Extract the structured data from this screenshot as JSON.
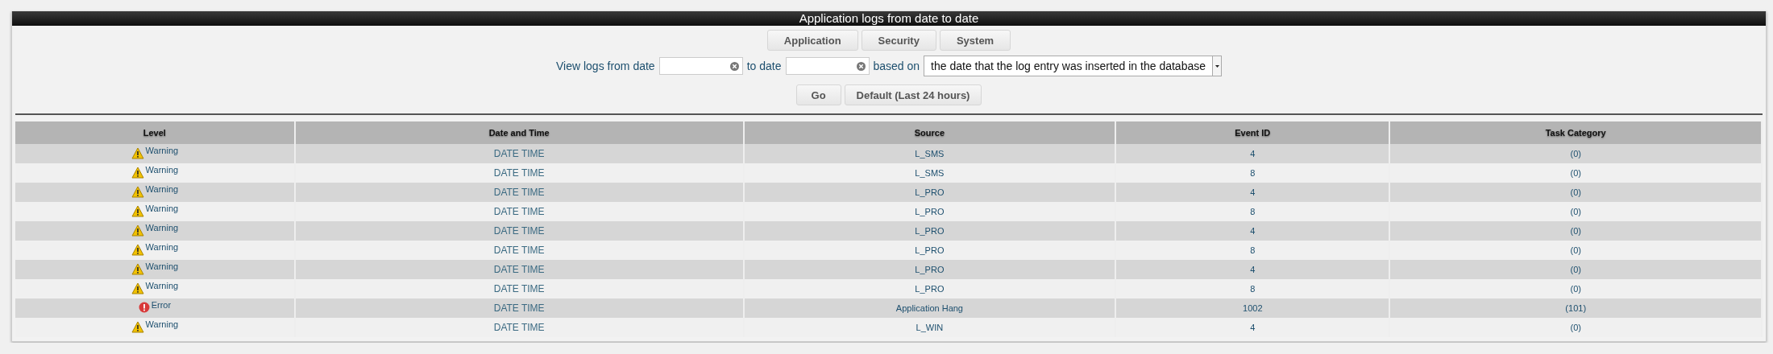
{
  "panel": {
    "title": "Application logs from date to date"
  },
  "tabs": [
    {
      "label": "Application"
    },
    {
      "label": "Security"
    },
    {
      "label": "System"
    }
  ],
  "filter": {
    "from_label": "View logs from date",
    "to_label": "to date",
    "based_on_label": "based on",
    "based_on": "the date that the log entry was inserted in the database"
  },
  "buttons": [
    "Go",
    "Default (Last 24 hours)"
  ],
  "table": {
    "columns": [
      "Level",
      "Date and Time",
      "Source",
      "Event ID",
      "Task Category"
    ],
    "rows": [
      {
        "kind": "warning",
        "level": "Warning",
        "datetime": "DATE TIME",
        "source": "L_SMS",
        "event_id": "4",
        "task_category": "(0)"
      },
      {
        "kind": "warning",
        "level": "Warning",
        "datetime": "DATE TIME",
        "source": "L_SMS",
        "event_id": "8",
        "task_category": "(0)"
      },
      {
        "kind": "warning",
        "level": "Warning",
        "datetime": "DATE TIME",
        "source": "L_PRO",
        "event_id": "4",
        "task_category": "(0)"
      },
      {
        "kind": "warning",
        "level": "Warning",
        "datetime": "DATE TIME",
        "source": "L_PRO",
        "event_id": "8",
        "task_category": "(0)"
      },
      {
        "kind": "warning",
        "level": "Warning",
        "datetime": "DATE TIME",
        "source": "L_PRO",
        "event_id": "4",
        "task_category": "(0)"
      },
      {
        "kind": "warning",
        "level": "Warning",
        "datetime": "DATE TIME",
        "source": "L_PRO",
        "event_id": "8",
        "task_category": "(0)"
      },
      {
        "kind": "warning",
        "level": "Warning",
        "datetime": "DATE TIME",
        "source": "L_PRO",
        "event_id": "4",
        "task_category": "(0)"
      },
      {
        "kind": "warning",
        "level": "Warning",
        "datetime": "DATE TIME",
        "source": "L_PRO",
        "event_id": "8",
        "task_category": "(0)"
      },
      {
        "kind": "error",
        "level": "Error",
        "datetime": "DATE TIME",
        "source": "Application Hang",
        "event_id": "1002",
        "task_category": "(101)"
      },
      {
        "kind": "warning",
        "level": "Warning",
        "datetime": "DATE TIME",
        "source": "L_WIN",
        "event_id": "4",
        "task_category": "(0)"
      }
    ]
  }
}
